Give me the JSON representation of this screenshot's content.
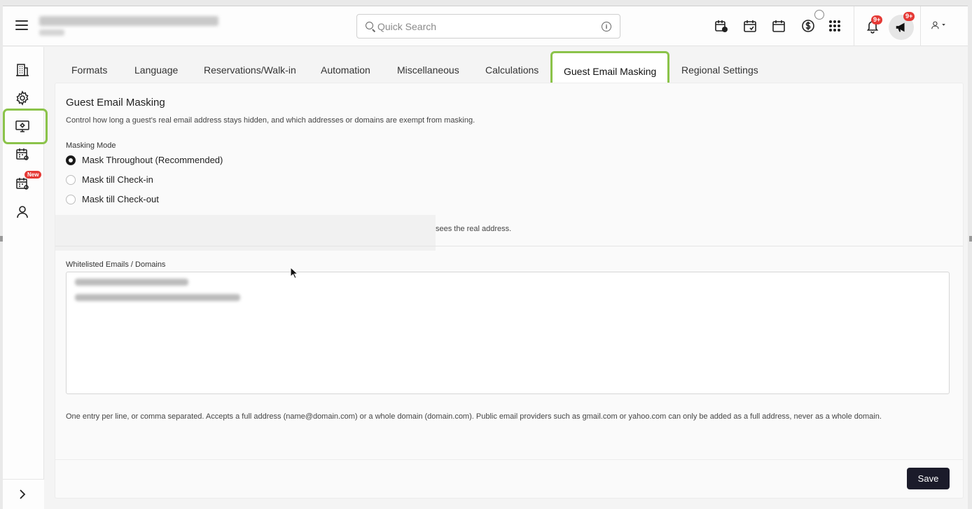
{
  "header": {
    "search_placeholder": "Quick Search",
    "notifications_badge": "9+",
    "announcements_badge": "9+"
  },
  "sidebar": {
    "new_badge": "New"
  },
  "tabs": [
    {
      "label": "Formats"
    },
    {
      "label": "Language"
    },
    {
      "label": "Reservations/Walk-in"
    },
    {
      "label": "Automation"
    },
    {
      "label": "Miscellaneous"
    },
    {
      "label": "Calculations"
    },
    {
      "label": "Guest Email Masking"
    },
    {
      "label": "Regional Settings"
    }
  ],
  "panel": {
    "title": "Guest Email Masking",
    "description": "Control how long a guest's real email address stays hidden, and which addresses or domains are exempt from masking.",
    "masking_mode_label": "Masking Mode",
    "options": [
      {
        "label": "Mask Throughout (Recommended)",
        "checked": true
      },
      {
        "label": "Mask till Check-in",
        "checked": false
      },
      {
        "label": "Mask till Check-out",
        "checked": false
      }
    ],
    "partial_note": "sees the real address.",
    "whitelist_label": "Whitelisted Emails / Domains",
    "help_text": "One entry per line, or comma separated. Accepts a full address (name@domain.com) or a whole domain (domain.com). Public email providers such as gmail.com or yahoo.com can only be added as a full address, never as a whole domain.",
    "save_label": "Save"
  },
  "colors": {
    "highlight": "#8bc34a",
    "badge": "#e53935",
    "save_button": "#1b1b2a"
  }
}
